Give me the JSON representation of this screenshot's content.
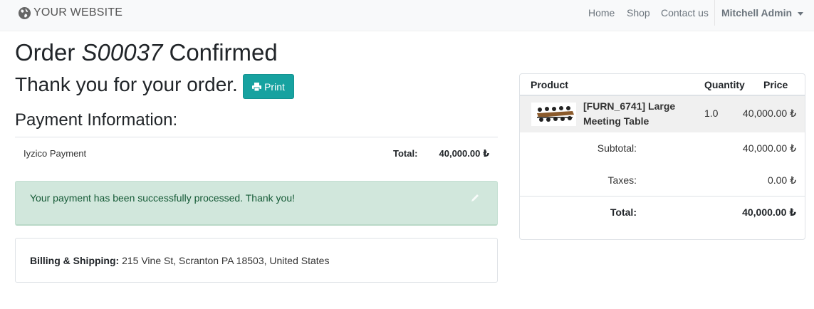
{
  "navbar": {
    "brand": "YOUR WEBSITE",
    "links": [
      "Home",
      "Shop",
      "Contact us"
    ],
    "user": "Mitchell Admin"
  },
  "order": {
    "title_prefix": "Order",
    "order_ref": "S00037",
    "title_suffix": "Confirmed",
    "thanks": "Thank you for your order.",
    "print_label": "Print"
  },
  "payment": {
    "heading": "Payment Information:",
    "method": "Iyzico Payment",
    "total_label": "Total:",
    "total_value": "40,000.00 ₺",
    "success_message": "Your payment has been successfully processed. Thank you!"
  },
  "billing": {
    "label": "Billing & Shipping:",
    "address": "215 Vine St, Scranton PA 18503, United States"
  },
  "summary": {
    "headers": {
      "product": "Product",
      "quantity": "Quantity",
      "price": "Price"
    },
    "line": {
      "name": "[FURN_6741] Large Meeting Table",
      "quantity": "1.0",
      "price": "40,000.00 ₺"
    },
    "subtotal_label": "Subtotal:",
    "subtotal_value": "40,000.00 ₺",
    "taxes_label": "Taxes:",
    "taxes_value": "0.00 ₺",
    "total_label": "Total:",
    "total_value": "40,000.00 ₺"
  },
  "colors": {
    "accent": "#17a2a0",
    "alert_bg": "#d1e7dc",
    "alert_text": "#155a36"
  },
  "icons": {
    "brand": "globe-icon",
    "print": "print-icon",
    "edit": "pencil-icon",
    "user": "chevron-down-icon"
  }
}
